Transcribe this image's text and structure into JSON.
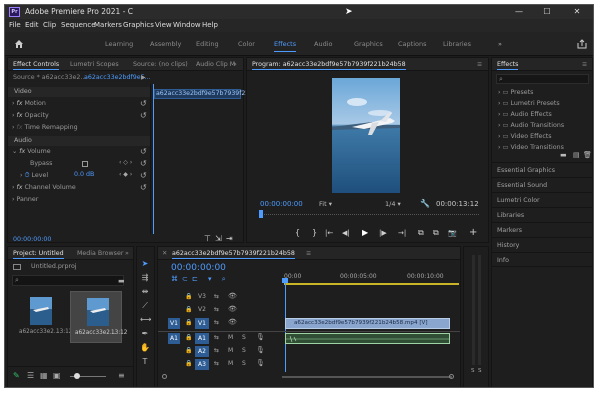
{
  "window": {
    "app_icon": "Pr",
    "title": "Adobe Premiere Pro 2021 - C",
    "cursor": "arrow-cursor-icon",
    "controls": [
      "minimize-icon",
      "maximize-icon",
      "close-icon"
    ]
  },
  "menu": [
    "File",
    "Edit",
    "Clip",
    "Sequence",
    "Markers",
    "Graphics",
    "View",
    "Window",
    "Help"
  ],
  "workspaces": {
    "home_icon": "home-icon",
    "items": [
      "Learning",
      "Assembly",
      "Editing",
      "Color",
      "Effects",
      "Audio",
      "Graphics",
      "Captions",
      "Libraries"
    ],
    "active": "Effects",
    "more": "»",
    "share_icon": "share-icon"
  },
  "effect_controls": {
    "tabs": [
      "Effect Controls",
      "Lumetri Scopes",
      "Source: (no clips)",
      "Audio Clip M"
    ],
    "active_tab": "Effect Controls",
    "menu_icon": "≡",
    "more": "»",
    "source": "Source * a62acc33e2...",
    "sequence": "a62acc33e2bdf9e5...",
    "clip_label": "a62acc33e2bdf9e57b7939f221b24",
    "video_header": "Video",
    "motion": "Motion",
    "opacity": "Opacity",
    "time_remapping": "Time Remapping",
    "audio_header": "Audio",
    "volume": "Volume",
    "bypass": "Bypass",
    "level": "Level",
    "level_value": "0.0 dB",
    "channel_volume": "Channel Volume",
    "panner": "Panner",
    "timecode": "00:00:00:00",
    "fx": "fx"
  },
  "program": {
    "tab": "Program: a62acc33e2bdf9e57b7939f221b24b58",
    "menu_icon": "≡",
    "timecode": "00:00:00:00",
    "fit": "Fit",
    "resolution": "1/4",
    "duration": "00:00:13:12",
    "wrench_icon": "wrench-icon",
    "controls": [
      "{",
      "}",
      "|←",
      "◀|",
      "▶",
      "|▶",
      "→|",
      "⧉",
      "⧉",
      "📷"
    ],
    "control_names": [
      "mark-in-icon",
      "mark-out-icon",
      "go-to-in-icon",
      "step-back-icon",
      "play-icon",
      "step-forward-icon",
      "go-to-out-icon",
      "insert-icon",
      "overwrite-icon",
      "export-frame-icon"
    ],
    "add_icon": "+"
  },
  "effects": {
    "title": "Effects",
    "menu_icon": "≡",
    "search_placeholder": "",
    "folders": [
      "Presets",
      "Lumetri Presets",
      "Audio Effects",
      "Audio Transitions",
      "Video Effects",
      "Video Transitions"
    ],
    "sections": [
      "Essential Graphics",
      "Essential Sound",
      "Lumetri Color",
      "Libraries",
      "Markers",
      "History",
      "Info"
    ]
  },
  "project": {
    "tabs": [
      "Project: Untitled",
      "Media Browser"
    ],
    "more": "»",
    "filename": "Untitled.prproj",
    "items": [
      {
        "name": "a62acc33e2...",
        "duration": "13:12"
      },
      {
        "name": "a62acc33e2...",
        "duration": "13:12"
      }
    ]
  },
  "timeline": {
    "sequence": "a62acc33e2bdf9e57b7939f221b24b58",
    "menu_icon": "≡",
    "timecode": "00:00:00:00",
    "ruler": [
      "00:00",
      "00:00:05:00",
      "00:00:10:00"
    ],
    "video_tracks": [
      "V3",
      "V2",
      "V1"
    ],
    "audio_tracks": [
      "A1",
      "A2",
      "A3"
    ],
    "video_clip": "a62acc33e2bdf9e57b7939f221b24b58.mp4 [V]",
    "mute": "M",
    "solo": "S",
    "meter_labels": [
      "S",
      "S"
    ]
  }
}
